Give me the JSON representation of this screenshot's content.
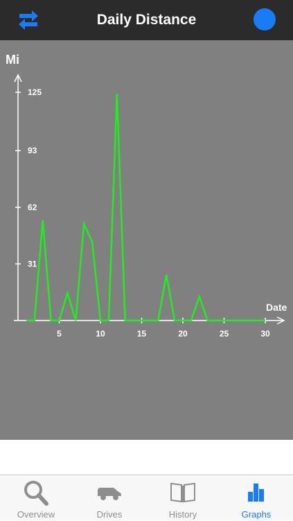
{
  "header": {
    "title": "Daily Distance",
    "swap_icon": "swap-arrows-icon",
    "status_color": "#1a7cf5"
  },
  "chart_data": {
    "type": "line",
    "ylabel": "Mi",
    "xlabel": "Date",
    "y_ticks": [
      31,
      62,
      93,
      125
    ],
    "x_ticks": [
      5,
      10,
      15,
      20,
      25,
      30
    ],
    "xlim": [
      0,
      30
    ],
    "ylim": [
      0,
      125
    ],
    "line_color": "#1eee1e",
    "x": [
      1,
      2,
      3,
      4,
      5,
      6,
      7,
      8,
      9,
      10,
      11,
      12,
      13,
      14,
      15,
      16,
      17,
      18,
      19,
      20,
      21,
      22,
      23,
      24,
      25,
      26,
      27,
      28,
      29,
      30
    ],
    "values": [
      0,
      0,
      55,
      0,
      0,
      15,
      0,
      53,
      43,
      0,
      0,
      124,
      0,
      0,
      0,
      0,
      0,
      25,
      0,
      0,
      0,
      13,
      0,
      0,
      0,
      0,
      0,
      0,
      0,
      0
    ]
  },
  "tabs": [
    {
      "label": "Overview",
      "icon": "magnifier-icon",
      "active": false
    },
    {
      "label": "Drives",
      "icon": "car-icon",
      "active": false
    },
    {
      "label": "History",
      "icon": "book-icon",
      "active": false
    },
    {
      "label": "Graphs",
      "icon": "graph-icon",
      "active": true
    }
  ]
}
